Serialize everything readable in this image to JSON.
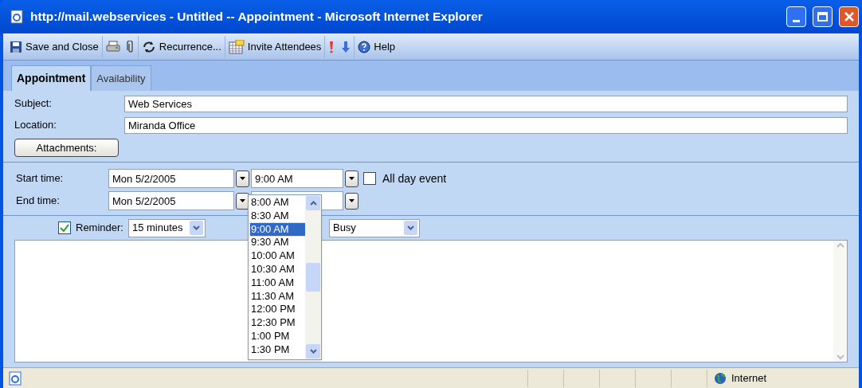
{
  "window": {
    "title": "http://mail.webservices - Untitled -- Appointment - Microsoft Internet Explorer"
  },
  "toolbar": [
    {
      "kind": "save",
      "label": "Save and Close"
    },
    {
      "kind": "print"
    },
    {
      "kind": "attach"
    },
    {
      "kind": "recurrence",
      "label": "Recurrence..."
    },
    {
      "kind": "invite",
      "label": "Invite Attendees"
    },
    {
      "kind": "high"
    },
    {
      "kind": "low"
    },
    {
      "kind": "help",
      "label": "Help"
    }
  ],
  "tabs": [
    {
      "label": "Appointment",
      "selected": true
    },
    {
      "label": "Availability",
      "selected": false
    }
  ],
  "subject": {
    "label": "Subject:",
    "value": "Web Services"
  },
  "location": {
    "label": "Location:",
    "value": "Miranda Office"
  },
  "attachments_button": "Attachments:",
  "start": {
    "label": "Start time:",
    "date": "Mon 5/2/2005",
    "time": "9:00 AM"
  },
  "end": {
    "label": "End time:",
    "date": "Mon 5/2/2005"
  },
  "all_day": {
    "label": "All day event",
    "checked": false
  },
  "reminder": {
    "label": "Reminder:",
    "checked": true,
    "value": "15 minutes"
  },
  "show_as": {
    "value": "Busy"
  },
  "time_list": [
    {
      "label": "8:00 AM",
      "selected": false
    },
    {
      "label": "8:30 AM",
      "selected": false
    },
    {
      "label": "9:00 AM",
      "selected": true
    },
    {
      "label": "9:30 AM",
      "selected": false
    },
    {
      "label": "10:00 AM",
      "selected": false
    },
    {
      "label": "10:30 AM",
      "selected": false
    },
    {
      "label": "11:00 AM",
      "selected": false
    },
    {
      "label": "11:30 AM",
      "selected": false
    },
    {
      "label": "12:00 PM",
      "selected": false
    },
    {
      "label": "12:30 PM",
      "selected": false
    },
    {
      "label": "1:00 PM",
      "selected": false
    },
    {
      "label": "1:30 PM",
      "selected": false
    }
  ],
  "status_bar": {
    "zone": "Internet"
  }
}
